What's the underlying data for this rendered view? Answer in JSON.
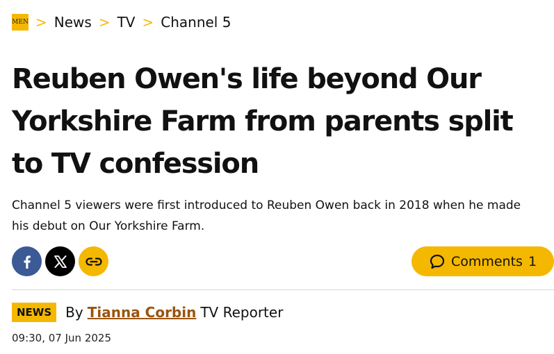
{
  "breadcrumb": {
    "logo_text": [
      "M",
      "EN"
    ],
    "items": [
      "News",
      "TV",
      "Channel 5"
    ],
    "separator": ">"
  },
  "article": {
    "headline": "Reuben Owen's life beyond Our Yorkshire Farm from parents split to TV confession",
    "standfirst": "Channel 5 viewers were first introduced to Reuben Owen back in 2018 when he made his debut on Our Yorkshire Farm."
  },
  "share": {
    "icons": [
      "facebook-icon",
      "x-icon",
      "link-icon"
    ]
  },
  "comments": {
    "label": "Comments",
    "count": "1"
  },
  "byline": {
    "badge": "NEWS",
    "by": "By",
    "author": "Tianna Corbin",
    "role": "TV Reporter",
    "timestamp": "09:30, 07 Jun 2025"
  },
  "colors": {
    "accent": "#f5b800",
    "facebook": "#3b5a96",
    "x": "#000000",
    "author_link": "#9a5410",
    "divider": "#d6d6d6"
  }
}
